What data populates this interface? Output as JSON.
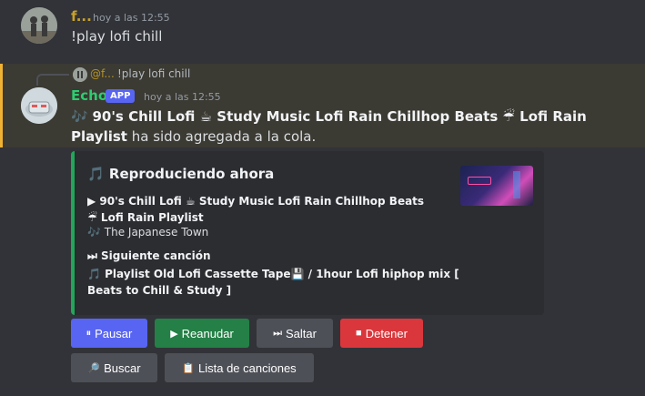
{
  "message1": {
    "username": "f...",
    "timestamp": "hoy a las 12:55",
    "content": "!play lofi chill"
  },
  "message2": {
    "reply": {
      "username": "@f...",
      "content": "!play lofi chill"
    },
    "bot_name": "Echo",
    "badge": "APP",
    "timestamp": "hoy a las 12:55",
    "content_icon": "🎶",
    "content_title": "90's Chill Lofi ☕ Study Music Lofi Rain Chillhop Beats ☔ Lofi Rain Playlist",
    "content_suffix": " ha sido agregada a la cola."
  },
  "embed": {
    "title_icon": "🎵",
    "title": "Reproduciendo ahora",
    "now_playing_icon": "▶",
    "now_playing": "90's Chill Lofi ☕ Study Music Lofi Rain Chillhop Beats ☔ Lofi Rain Playlist",
    "artist_icon": "🎶",
    "artist": "The Japanese Town",
    "next_icon": "⏭",
    "next_label": "Siguiente canción",
    "next_track_icon": "🎵",
    "next_track": "Playlist Old Lofi Cassette Tape💾 / 1hour Lofi hiphop mix [ Beats to Chill & Study ]",
    "accent_color": "#23a55a"
  },
  "buttons": {
    "pause": {
      "icon": "⏸",
      "label": "Pausar"
    },
    "resume": {
      "icon": "▶",
      "label": "Reanudar"
    },
    "skip": {
      "icon": "⏭",
      "label": "Saltar"
    },
    "stop": {
      "icon": "■",
      "label": "Detener"
    },
    "search": {
      "icon": "🔎",
      "label": "Buscar"
    },
    "queue": {
      "icon": "📋",
      "label": "Lista de canciones"
    }
  }
}
